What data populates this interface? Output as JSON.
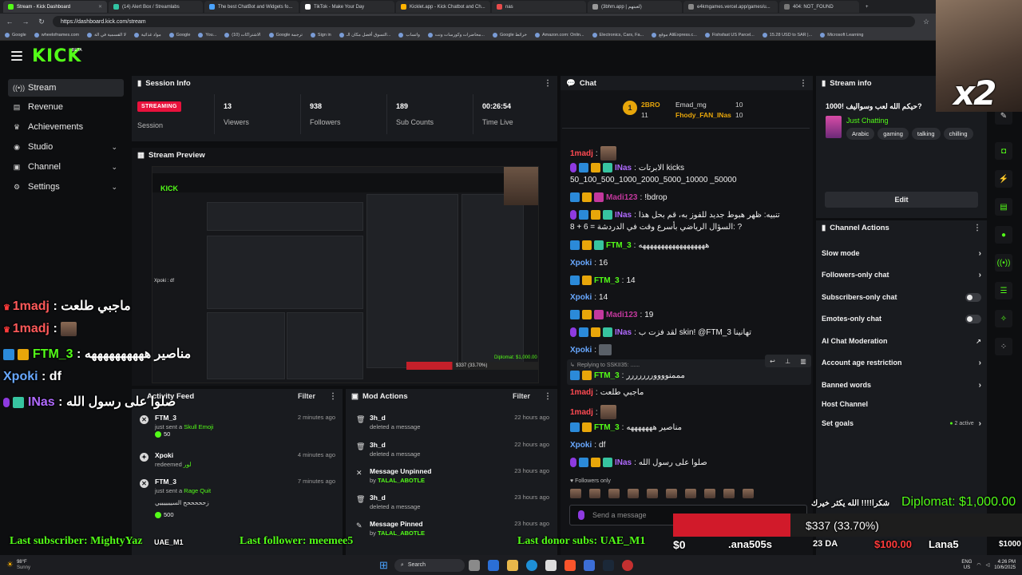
{
  "browser": {
    "tabs": [
      {
        "label": "Stream - Kick Dashboard",
        "active": true
      },
      {
        "label": "(14) Alert Box / Streamlabs"
      },
      {
        "label": "The best ChatBot and Widgets fo..."
      },
      {
        "label": "TikTok - Make Your Day"
      },
      {
        "label": "Kicklet.app - Kick Chatbot and Ch..."
      },
      {
        "label": "nas"
      },
      {
        "label": "(3bhm.app | لعبتهم)"
      },
      {
        "label": "e4kmgames.vercel.app/games/u..."
      },
      {
        "label": "404: NOT_FOUND"
      }
    ],
    "url": "https://dashboard.kick.com/stream",
    "bookmarks": [
      "Google",
      "wheelofnames.com",
      "لا القسمية في الة",
      "مواد غذائية",
      "Google",
      "You...",
      "(10) الاشتراكات",
      "Google ترجمة",
      "Sign in",
      "التسوق أفضل مكان الـ...",
      "واتساب",
      "محاضرات وكورسات ونت...",
      "Google خرائط",
      "Amazon.com: Onlin...",
      "Electronics, Cars, Fa...",
      "موقع AliExpress.c...",
      "Fishsfast US Parcel...",
      "15.28 USD to SAR |...",
      "Microsoft Learning"
    ]
  },
  "brand": {
    "logo": "KICK",
    "beta": "BETA",
    "accent": "#53fc18"
  },
  "sidebar": {
    "items": [
      {
        "label": "Stream",
        "icon": "stream-icon",
        "active": true
      },
      {
        "label": "Revenue",
        "icon": "revenue-icon"
      },
      {
        "label": "Achievements",
        "icon": "trophy-icon"
      },
      {
        "label": "Studio",
        "icon": "studio-icon",
        "expandable": true
      },
      {
        "label": "Channel",
        "icon": "channel-icon",
        "expandable": true
      },
      {
        "label": "Settings",
        "icon": "gear-icon",
        "expandable": true
      }
    ]
  },
  "session": {
    "title": "Session Info",
    "badge": "STREAMING",
    "badge_label": "Session",
    "stats": [
      {
        "value": "13",
        "label": "Viewers"
      },
      {
        "value": "938",
        "label": "Followers"
      },
      {
        "value": "189",
        "label": "Sub Counts"
      },
      {
        "value": "00:26:54",
        "label": "Time Live"
      }
    ]
  },
  "preview": {
    "title": "Stream Preview"
  },
  "activity": {
    "title": "Activity Feed",
    "filter": "Filter",
    "rows": [
      {
        "user": "FTM_3",
        "action": "just sent a",
        "item": "Skull Emoji",
        "amount": "50",
        "time": "2 minutes ago"
      },
      {
        "user": "Xpoki",
        "action": "redeemed",
        "item": "لور",
        "time": "4 minutes ago"
      },
      {
        "user": "FTM_3",
        "action": "just sent a",
        "item": "Rage Quit",
        "note": "زحححححح السيييييييي",
        "amount": "500",
        "time": "7 minutes ago"
      }
    ]
  },
  "mod": {
    "title": "Mod Actions",
    "filter": "Filter",
    "rows": [
      {
        "user": "3h_d",
        "action": "deleted a message",
        "time": "22 hours ago"
      },
      {
        "user": "3h_d",
        "action": "deleted a message",
        "time": "22 hours ago"
      },
      {
        "user": "Message Unpinned",
        "action": "by",
        "by": "TALAL_ABOTLE",
        "time": "23 hours ago"
      },
      {
        "user": "3h_d",
        "action": "deleted a message",
        "time": "23 hours ago"
      },
      {
        "user": "Message Pinned",
        "action": "by",
        "by": "TALAL_ABOTLE",
        "time": "23 hours ago"
      }
    ]
  },
  "chat": {
    "title": "Chat",
    "leaders": [
      {
        "rank": "1",
        "name": "2BRO",
        "count": "11"
      },
      {
        "name": "Emad_mg",
        "count": "10"
      },
      {
        "name": "Fhody_FAN_INas",
        "count": "10"
      }
    ],
    "messages": [
      {
        "user": "1madj",
        "text": "",
        "emote": true
      },
      {
        "user": "INas",
        "text": "الابرتات kicks"
      },
      {
        "user": "",
        "text": "50_100_500_1000_2000_5000_10000 _50000"
      },
      {
        "user": "Madi123",
        "text": "!bdrop"
      },
      {
        "user": "INas",
        "text": "تنبيه: ظهر هبوط جديد   للفوز به، قم بحل هذا"
      },
      {
        "user": "",
        "text": "8 + 6 = السؤال الرياضي بأسرع وقت في الدردشة: ?"
      },
      {
        "user": "FTM_3",
        "text": "ههههههههههههههههههه"
      },
      {
        "user": "Xpoki",
        "text": "16"
      },
      {
        "user": "FTM_3",
        "text": "14"
      },
      {
        "user": "Xpoki",
        "text": "14"
      },
      {
        "user": "Madi123",
        "text": "19"
      },
      {
        "user": "INas",
        "text": "لقد فزت ب skin! @FTM_3 تهانينا"
      },
      {
        "user": "Xpoki",
        "text": "",
        "emote": true
      },
      {
        "user": "",
        "text": "Replying to SSKII35: ......"
      },
      {
        "user": "FTM_3",
        "text": "مممنووووررررررر"
      },
      {
        "user": "1madj",
        "text": "ماجبي طلعت"
      },
      {
        "user": "1madj",
        "text": "",
        "emote": true
      },
      {
        "user": "FTM_3",
        "text": "مناصير هههههههه"
      },
      {
        "user": "Xpoki",
        "text": "df"
      },
      {
        "user": "INas",
        "text": "صلوا على رسول الله"
      }
    ],
    "followers_only": "Followers only",
    "placeholder": "Send a message"
  },
  "streaminfo": {
    "title": "Stream info",
    "stream_title": "حيكم الله لعب وسواليف !1000?",
    "category": "Just Chatting",
    "tags": [
      "Arabic",
      "gaming",
      "talking",
      "chilling"
    ],
    "edit": "Edit"
  },
  "actions": {
    "title": "Channel Actions",
    "items": [
      {
        "label": "Slow mode",
        "type": "chevron"
      },
      {
        "label": "Followers-only chat",
        "type": "chevron"
      },
      {
        "label": "Subscribers-only chat",
        "type": "toggle"
      },
      {
        "label": "Emotes-only chat",
        "type": "toggle"
      },
      {
        "label": "AI Chat Moderation",
        "type": "external"
      },
      {
        "label": "Account age restriction",
        "type": "chevron"
      },
      {
        "label": "Banned words",
        "type": "chevron"
      },
      {
        "label": "Host Channel",
        "type": "none"
      },
      {
        "label": "Set goals",
        "type": "chevron",
        "badge": "2 active"
      }
    ]
  },
  "overlay": {
    "chat": [
      {
        "user": "1madj",
        "text": ": ماجبي طلعت"
      },
      {
        "user": "1madj",
        "text": ":"
      },
      {
        "user": "FTM_3",
        "text": ": مناصير ههههههههههه"
      },
      {
        "user": "Xpoki",
        "text": ": df"
      },
      {
        "user": "INas",
        "text": ": صلوا على رسول الله"
      }
    ],
    "x2": "x2",
    "last_subscriber": "Last subscriber: MightyYaz",
    "last_follower": "Last follower: meemee5",
    "last_donor": "Last donor subs: UAE_M1",
    "subbed": "UAE_M1",
    "thanks": "شكرا!!!! الله يكثر خيرك",
    "diplomat": "Diplomat: $1,000.00",
    "goal_text": "$337 (33.70%)",
    "goal_progress": 0.337,
    "goal_min": "$0",
    "goal_max": "$100.00",
    "goal_end": "$1000",
    "ticker": [
      ".ana505s",
      "23 DA",
      "Lana5"
    ]
  },
  "taskbar": {
    "weather_temp": "98°F",
    "weather_cond": "Sunny",
    "search": "Search",
    "lang": "ENG",
    "region": "US",
    "time": "4:26 PM",
    "date": "10/6/2025"
  }
}
